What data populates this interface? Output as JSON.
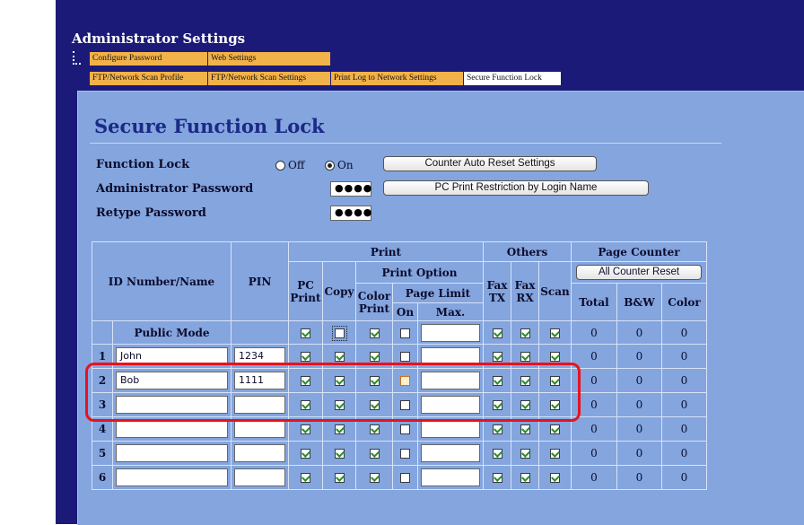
{
  "admin": {
    "title": "Administrator Settings"
  },
  "tabs": {
    "row1": [
      "Configure Password",
      "Web Settings"
    ],
    "row2": [
      "FTP/Network Scan Profile",
      "FTP/Network Scan Settings",
      "Print Log to Network Settings",
      "Secure Function Lock"
    ]
  },
  "page": {
    "title": "Secure Function Lock"
  },
  "form": {
    "function_lock_label": "Function Lock",
    "off_label": "Off",
    "on_label": "On",
    "function_lock_value": "On",
    "admin_password_label": "Administrator Password",
    "admin_password_value": "●●●●",
    "retype_password_label": "Retype Password",
    "retype_password_value": "●●●●",
    "counter_reset_button": "Counter Auto Reset Settings",
    "pc_print_restriction_button": "PC Print Restriction by Login Name"
  },
  "table": {
    "headers": {
      "id_name": "ID Number/Name",
      "pin": "PIN",
      "print": "Print",
      "others": "Others",
      "page_counter": "Page Counter",
      "print_option": "Print Option",
      "all_counter_reset": "All Counter Reset",
      "pc_print": "PC Print",
      "copy": "Copy",
      "color_print": "Color Print",
      "page_limit": "Page Limit",
      "on": "On",
      "max": "Max.",
      "fax_tx": "Fax TX",
      "fax_rx": "Fax RX",
      "scan": "Scan",
      "total": "Total",
      "bw": "B&W",
      "color": "Color"
    },
    "public_mode": {
      "label": "Public Mode",
      "pc_print": true,
      "copy": false,
      "color_print": true,
      "page_limit_on": false,
      "fax_tx": true,
      "fax_rx": true,
      "scan": true,
      "total": "0",
      "bw": "0",
      "color": "0"
    },
    "rows": [
      {
        "num": "1",
        "name": "John",
        "pin": "1234",
        "total": "0",
        "bw": "0",
        "color": "0"
      },
      {
        "num": "2",
        "name": "Bob",
        "pin": "1111",
        "total": "0",
        "bw": "0",
        "color": "0"
      },
      {
        "num": "3",
        "name": "",
        "pin": "",
        "total": "0",
        "bw": "0",
        "color": "0"
      },
      {
        "num": "4",
        "name": "",
        "pin": "",
        "total": "0",
        "bw": "0",
        "color": "0"
      },
      {
        "num": "5",
        "name": "",
        "pin": "",
        "total": "0",
        "bw": "0",
        "color": "0"
      },
      {
        "num": "6",
        "name": "",
        "pin": "",
        "total": "0",
        "bw": "0",
        "color": "0"
      }
    ]
  }
}
